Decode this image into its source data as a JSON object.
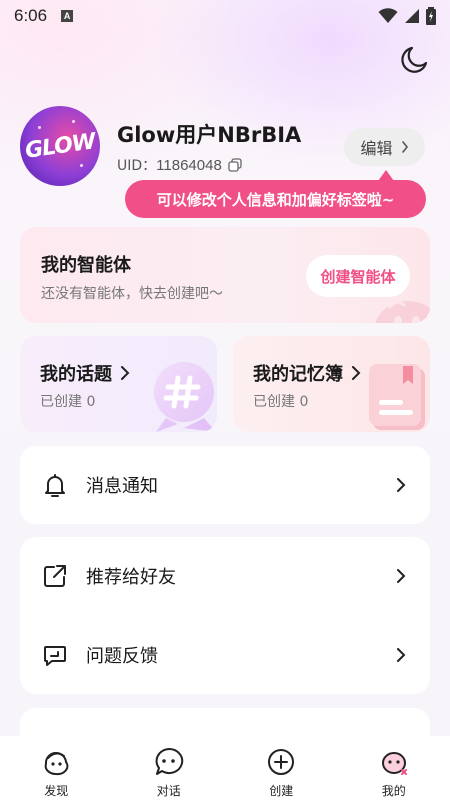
{
  "status_bar": {
    "time": "6:06",
    "notification_badge": "A"
  },
  "profile": {
    "avatar_text": "GLOW",
    "username": "Glow用户NBrBIA",
    "uid_label": "UID：",
    "uid_value": "11864048",
    "edit_label": "编辑",
    "tooltip": "可以修改个人信息和加偏好标签啦~"
  },
  "agent_card": {
    "title": "我的智能体",
    "subtitle": "还没有智能体，快去创建吧〜",
    "button": "创建智能体"
  },
  "topic_card": {
    "title": "我的话题",
    "subtitle": "已创建 0"
  },
  "memo_card": {
    "title": "我的记忆簿",
    "subtitle": "已创建 0"
  },
  "menu": {
    "notifications": "消息通知",
    "recommend": "推荐给好友",
    "feedback": "问题反馈"
  },
  "tabs": [
    {
      "label": "发现",
      "icon": "discover-icon"
    },
    {
      "label": "对话",
      "icon": "chat-icon"
    },
    {
      "label": "创建",
      "icon": "plus-icon"
    },
    {
      "label": "我的",
      "icon": "mine-icon"
    }
  ],
  "colors": {
    "accent": "#f14f87",
    "background": "#f7f5fa",
    "card": "#ffffff"
  }
}
